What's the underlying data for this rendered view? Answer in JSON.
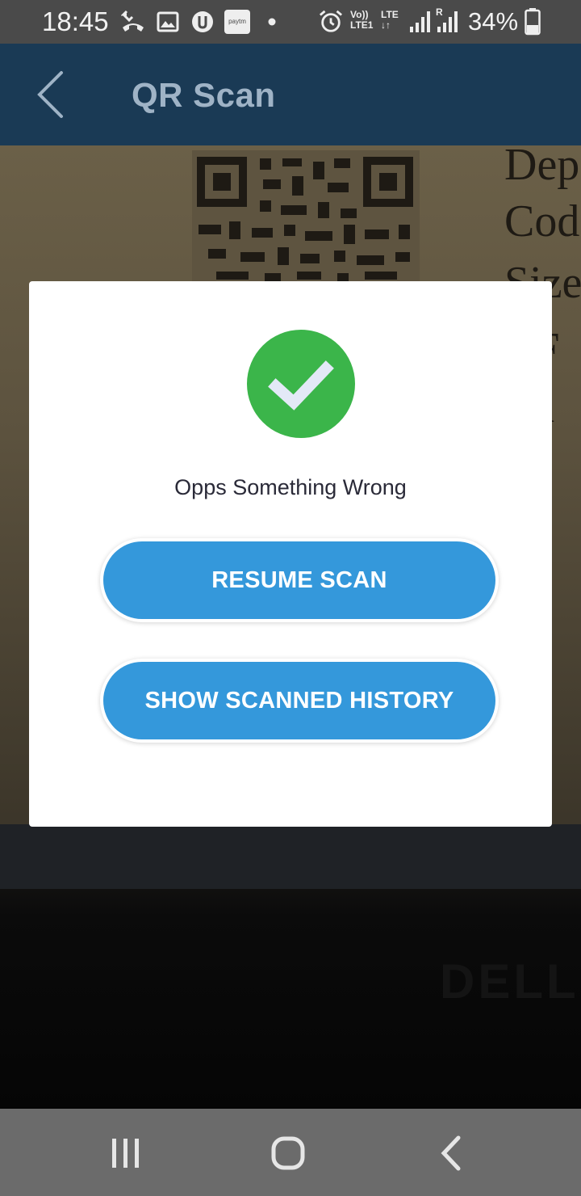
{
  "status_bar": {
    "time": "18:45",
    "icons": [
      "missed-call-icon",
      "gallery-icon",
      "app-icon",
      "paytm-icon",
      "dot-icon",
      "alarm-icon",
      "volte-icon",
      "lte-icon",
      "signal-icon",
      "signal-roaming-icon",
      "battery-icon"
    ],
    "paytm_label": "paytm",
    "volte_label": "Vo))",
    "lte1_label": "LTE1",
    "lte_label": "LTE",
    "roaming_label": "R",
    "battery_percent": "34%"
  },
  "app_bar": {
    "title": "QR Scan",
    "back_icon": "back-arrow-icon"
  },
  "background_text": [
    "Dep",
    "Cod",
    "Size",
    "RF",
    "Lu"
  ],
  "watermark_text": "DELL",
  "dialog": {
    "icon": "check-circle-icon",
    "message": "Opps Something Wrong",
    "resume_label": "RESUME SCAN",
    "history_label": "SHOW SCANNED HISTORY"
  },
  "nav_bar": {
    "recents_icon": "recents-icon",
    "home_icon": "home-icon",
    "back_icon": "nav-back-icon"
  },
  "colors": {
    "app_bar": "#1a3a55",
    "button": "#3498db",
    "success": "#3bb54a"
  }
}
